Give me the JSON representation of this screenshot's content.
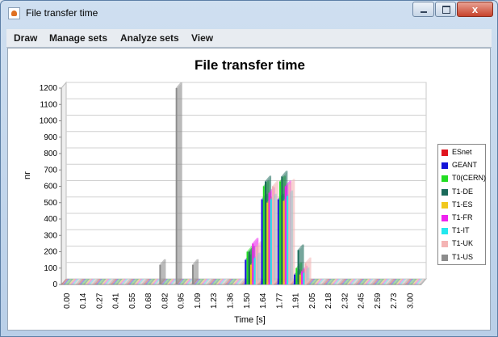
{
  "window": {
    "title": "File transfer time",
    "close_glyph": "x"
  },
  "menu": {
    "items": [
      "Draw",
      "Manage sets",
      "Analyze sets",
      "View"
    ]
  },
  "icons": {
    "app": "java-cup-icon",
    "minimize": "minimize-icon",
    "maximize": "maximize-icon",
    "close": "close-icon"
  },
  "chart_data": {
    "type": "bar",
    "title": "File transfer time",
    "xlabel": "Time [s]",
    "ylabel": "nr",
    "ylim": [
      0,
      1200
    ],
    "yticks": [
      0,
      100,
      200,
      300,
      400,
      500,
      600,
      700,
      800,
      900,
      1000,
      1100,
      1200
    ],
    "categories": [
      "0.00",
      "0.14",
      "0.27",
      "0.41",
      "0.55",
      "0.68",
      "0.82",
      "0.95",
      "1.09",
      "1.23",
      "1.36",
      "1.50",
      "1.64",
      "1.77",
      "1.91",
      "2.05",
      "2.18",
      "2.32",
      "2.45",
      "2.59",
      "2.73",
      "3.00"
    ],
    "grid": true,
    "legend_position": "right",
    "series": [
      {
        "name": "ESnet",
        "color": "#e0141e",
        "values": [
          0,
          0,
          0,
          0,
          0,
          0,
          0,
          0,
          0,
          0,
          0,
          0,
          0,
          0,
          0,
          0,
          0,
          0,
          0,
          0,
          0,
          0
        ]
      },
      {
        "name": "GEANT",
        "color": "#1414d8",
        "values": [
          0,
          0,
          0,
          0,
          0,
          0,
          0,
          0,
          0,
          0,
          0,
          150,
          520,
          520,
          60,
          0,
          0,
          0,
          0,
          0,
          0,
          0
        ]
      },
      {
        "name": "T0(CERN)",
        "color": "#22dd22",
        "values": [
          0,
          0,
          0,
          0,
          0,
          0,
          0,
          0,
          0,
          0,
          0,
          200,
          600,
          630,
          100,
          0,
          0,
          0,
          0,
          0,
          0,
          0
        ]
      },
      {
        "name": "T1-DE",
        "color": "#1a6a5a",
        "values": [
          0,
          0,
          0,
          0,
          0,
          0,
          0,
          0,
          0,
          0,
          0,
          200,
          630,
          660,
          210,
          0,
          0,
          0,
          0,
          0,
          0,
          0
        ]
      },
      {
        "name": "T1-ES",
        "color": "#f0c81e",
        "values": [
          0,
          0,
          0,
          0,
          0,
          0,
          0,
          0,
          0,
          0,
          0,
          120,
          500,
          510,
          60,
          0,
          0,
          0,
          0,
          0,
          0,
          0
        ]
      },
      {
        "name": "T1-FR",
        "color": "#ee22ee",
        "values": [
          0,
          0,
          0,
          0,
          0,
          0,
          0,
          0,
          0,
          0,
          0,
          250,
          560,
          600,
          80,
          0,
          0,
          0,
          0,
          0,
          0,
          0
        ]
      },
      {
        "name": "T1-IT",
        "color": "#22e8ee",
        "values": [
          0,
          0,
          0,
          0,
          0,
          0,
          0,
          0,
          0,
          0,
          0,
          160,
          520,
          540,
          70,
          0,
          0,
          0,
          0,
          0,
          0,
          0
        ]
      },
      {
        "name": "T1-UK",
        "color": "#f4b4b4",
        "values": [
          0,
          0,
          0,
          0,
          0,
          0,
          0,
          0,
          0,
          0,
          0,
          230,
          600,
          610,
          130,
          0,
          0,
          0,
          0,
          0,
          0,
          0
        ]
      },
      {
        "name": "T1-US",
        "color": "#8c8c8c",
        "values": [
          0,
          0,
          0,
          0,
          0,
          120,
          1200,
          120,
          0,
          0,
          0,
          0,
          0,
          0,
          0,
          0,
          0,
          0,
          0,
          0,
          0,
          0
        ]
      }
    ]
  }
}
